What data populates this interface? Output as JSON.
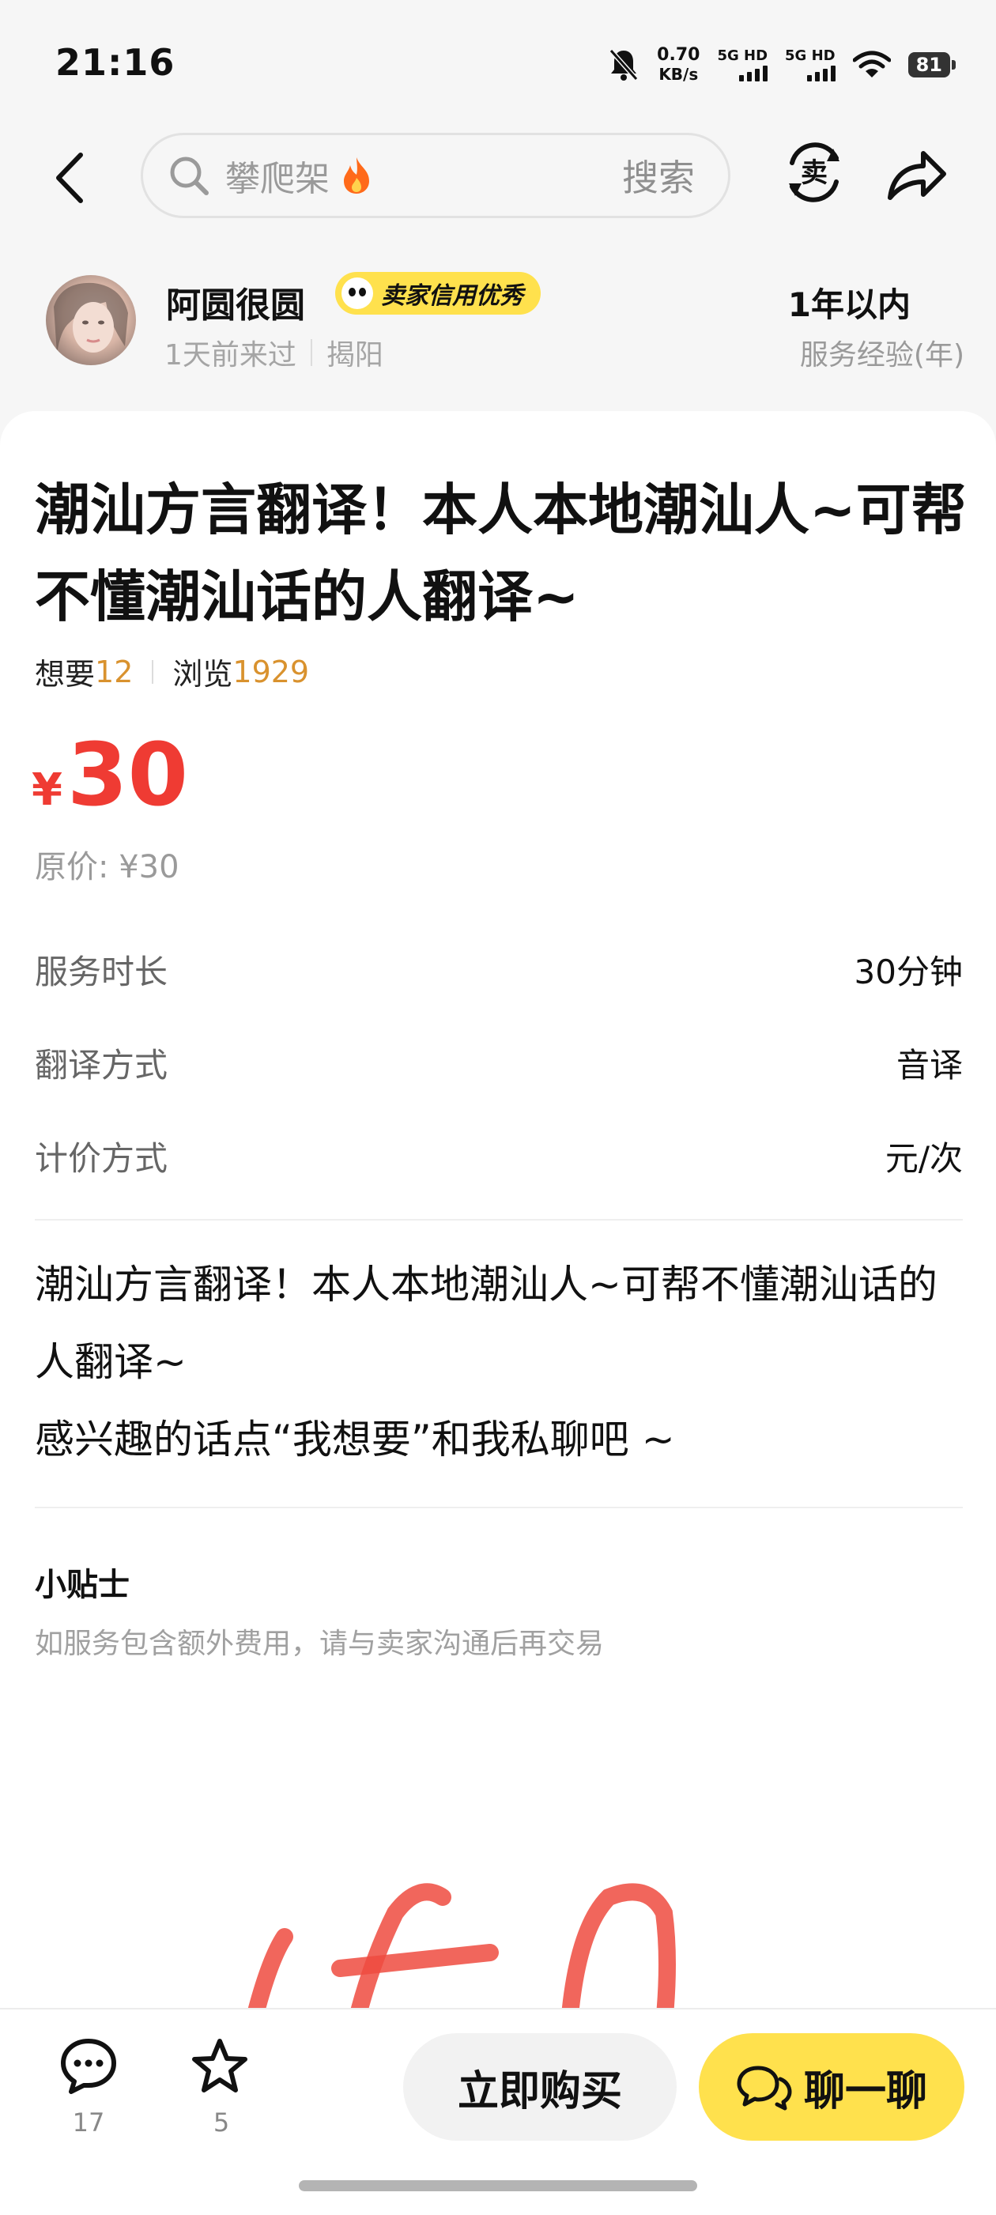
{
  "status_bar": {
    "time": "21:16",
    "net_speed_value": "0.70",
    "net_speed_unit": "KB/s",
    "sim1": "5G HD",
    "sim2": "5G HD",
    "battery": "81"
  },
  "nav": {
    "search_placeholder": "攀爬架",
    "search_button": "搜索",
    "sell_label": "卖"
  },
  "seller": {
    "name": "阿圆很圆",
    "badge": "卖家信用优秀",
    "last_seen": "1天前来过",
    "location": "揭阳",
    "experience_value": "1年以内",
    "experience_label": "服务经验(年)"
  },
  "item": {
    "title": "潮汕方言翻译！本人本地潮汕人~可帮不懂潮汕话的人翻译~",
    "want_label": "想要",
    "want_count": "12",
    "views_label": "浏览",
    "views_count": "1929",
    "currency": "¥",
    "price": "30",
    "original_price": "原价: ¥30",
    "attributes": [
      {
        "key": "服务时长",
        "value": "30分钟"
      },
      {
        "key": "翻译方式",
        "value": "音译"
      },
      {
        "key": "计价方式",
        "value": "元/次"
      }
    ],
    "description_line1": "潮汕方言翻译！本人本地潮汕人~可帮不懂潮汕话的人翻译~",
    "description_line2": "感兴趣的话点“我想要”和我私聊吧 ~",
    "tips_title": "小贴士",
    "tips_text": "如服务包含额外费用，请与卖家沟通后再交易"
  },
  "bottom_bar": {
    "comment_count": "17",
    "favorite_count": "5",
    "buy_label": "立即购买",
    "chat_label": "聊一聊"
  },
  "colors": {
    "price": "#ef3b33",
    "stat_number": "#d9922e",
    "accent_yellow": "#ffe14d"
  },
  "icons": [
    "back-icon",
    "search-icon",
    "fire-icon",
    "sell-icon",
    "share-icon",
    "comment-icon",
    "star-icon",
    "chat-icon"
  ]
}
